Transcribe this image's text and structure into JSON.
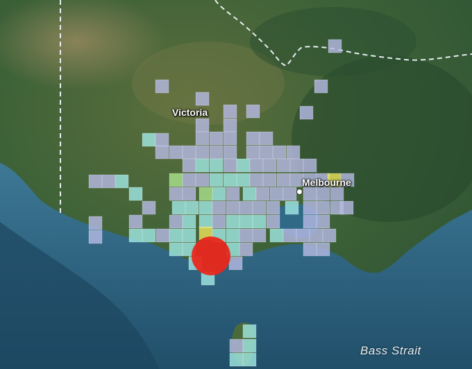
{
  "labels": {
    "state": "Victoria",
    "city": "Melbourne",
    "water": "Bass Strait"
  },
  "colors": {
    "land_dark": "#2f5a3a",
    "land_light": "#6e7a48",
    "land_dry": "#8b7a55",
    "sea_shelf": "#3d7690",
    "sea_deep": "#1f4f6b",
    "cell_lavender": "#b4b8e2",
    "cell_cyan": "#9fe6e2",
    "cell_green": "#a8e08a",
    "cell_yellow": "#e8e05a",
    "marker_red": "#e8281e",
    "border_line": "#e8eef2"
  },
  "icons": [
    "city-dot-icon",
    "event-marker-icon"
  ]
}
